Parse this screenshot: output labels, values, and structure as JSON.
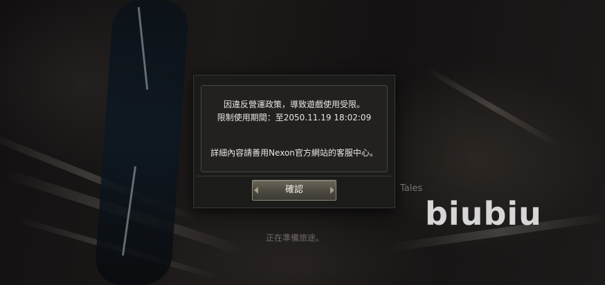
{
  "background": {
    "subtitle_text": "Tales",
    "loading_text": "正在準備旅途。"
  },
  "watermark": "biubiu",
  "dialog": {
    "line1": "因違反營運政策，導致遊戲使用受限。",
    "line2": "限制使用期間：至2050.11.19 18:02:09",
    "line3": "詳細內容請善用Nexon官方網站的客服中心。",
    "confirm_label": "確認"
  },
  "colors": {
    "dialog_bg": "#1b1b1a",
    "text": "#e9e6e0",
    "button_gold": "#8f8a7a"
  }
}
